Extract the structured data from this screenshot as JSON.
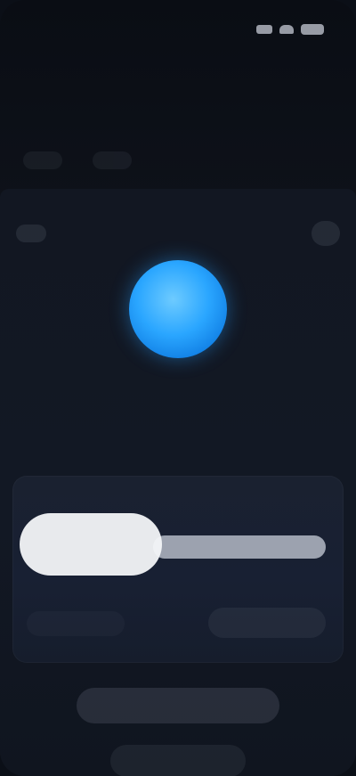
{
  "status_bar": {
    "time": "",
    "icons": [
      "signal-icon",
      "wifi-icon",
      "battery-icon"
    ]
  },
  "header": {
    "title": "",
    "meta": [
      "",
      ""
    ]
  },
  "profile": {
    "avatar_initial": "",
    "name": "",
    "subtitle": ""
  },
  "card": {
    "left_label": "",
    "right_label": "",
    "slider_value": 0.45
  },
  "buttons": {
    "primary_label": "",
    "secondary_label": ""
  },
  "colors": {
    "background": "#0b0f17",
    "accent": "#2aa6ff",
    "card": "#182033"
  }
}
